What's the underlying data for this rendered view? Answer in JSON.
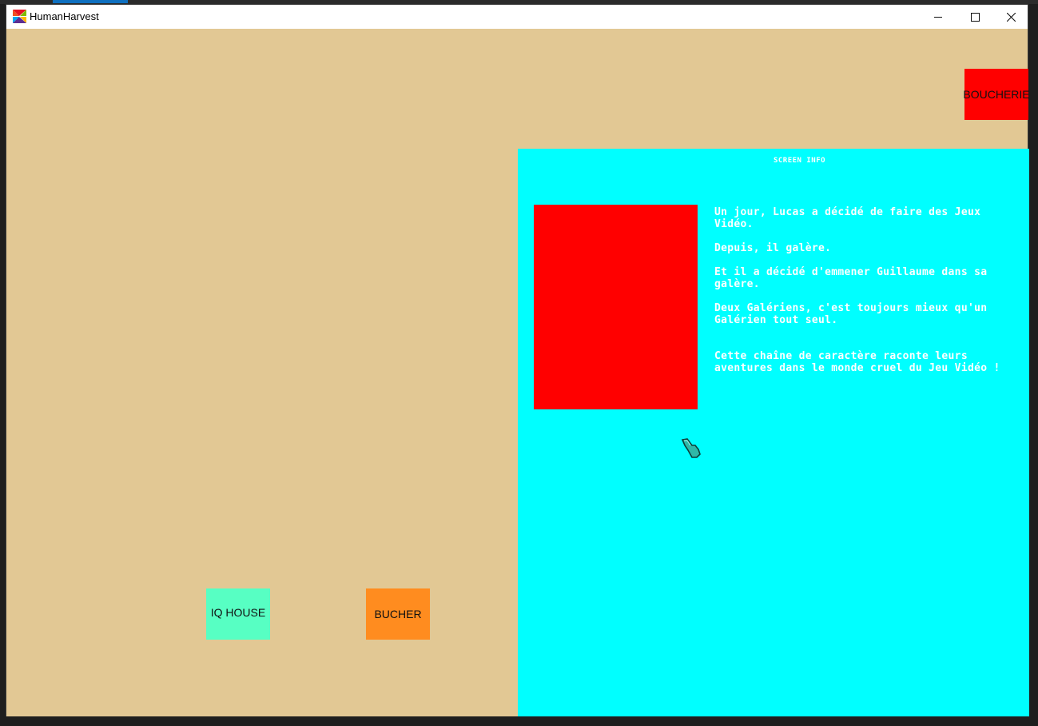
{
  "window": {
    "title": "HumanHarvest",
    "minimize": "—",
    "maximize": "☐",
    "close": "✕"
  },
  "buildings": {
    "boucherie": "BOUCHERIE",
    "iq_house": "IQ HOUSE",
    "bucher": "BUCHER"
  },
  "screen_info": {
    "title": "SCREEN INFO",
    "paragraphs": [
      "Un jour, Lucas a décidé de faire des Jeux Vidéo.",
      "Depuis, il galère.",
      "Et il a décidé d'emmener Guillaume dans sa galère.",
      "Deux Galériens, c'est toujours mieux qu'un Galérien tout seul.",
      "Cette chaîne de caractère raconte leurs aventures dans le monde cruel du Jeu Vidéo !"
    ]
  },
  "colors": {
    "ground": "#e2c894",
    "boucherie": "#ff0000",
    "iq_house": "#57ffc3",
    "bucher": "#ff8c1f",
    "info_panel": "#00ffff",
    "portrait": "#ff0000"
  },
  "icons": {
    "app": "app-logo-icon",
    "cursor": "pointing-hand-cursor-icon"
  }
}
